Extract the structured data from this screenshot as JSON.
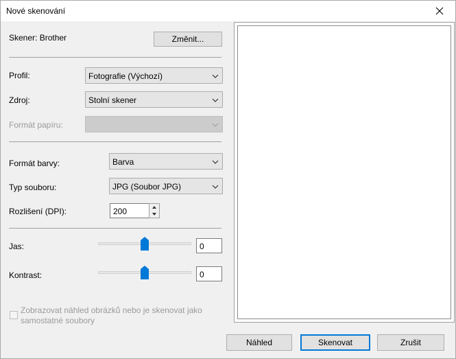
{
  "window": {
    "title": "Nové skenování"
  },
  "scanner": {
    "label": "Skener: Brother",
    "change_button": "Změnit..."
  },
  "profile": {
    "label": "Profil:",
    "value": "Fotografie (Výchozí)"
  },
  "source": {
    "label": "Zdroj:",
    "value": "Stolní skener"
  },
  "paper_size": {
    "label": "Formát papíru:",
    "value": ""
  },
  "color_format": {
    "label": "Formát barvy:",
    "value": "Barva"
  },
  "file_type": {
    "label": "Typ souboru:",
    "value": "JPG (Soubor JPG)"
  },
  "resolution": {
    "label": "Rozlišení (DPI):",
    "value": "200"
  },
  "brightness": {
    "label": "Jas:",
    "value": "0",
    "slider_fraction": 0.5
  },
  "contrast": {
    "label": "Kontrast:",
    "value": "0",
    "slider_fraction": 0.5
  },
  "preview_checkbox": {
    "label_line1": "Zobrazovat náhled obrázků nebo je skenovat jako",
    "label_line2": "samostatné soubory",
    "checked": false
  },
  "buttons": {
    "preview": "Náhled",
    "scan": "Skenovat",
    "cancel": "Zrušit"
  },
  "colors": {
    "accent": "#0078d7",
    "disabled_text": "#9a9a9a"
  }
}
